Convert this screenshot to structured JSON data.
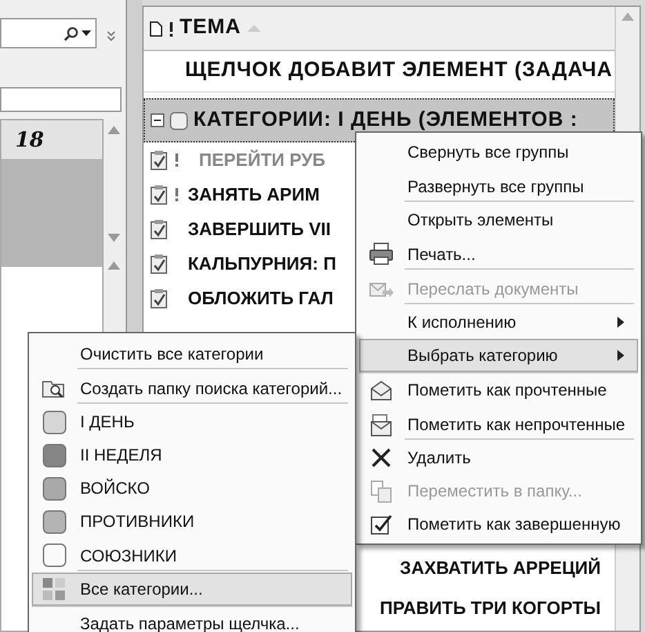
{
  "calendar": {
    "day": "18"
  },
  "task_list": {
    "column": "ТЕМА",
    "new_item_row": "ЩЕЛЧОК ДОБАВИТ ЭЛЕМЕНТ (ЗАДАЧА",
    "group": {
      "label": "КАТЕГОРИИ: I ДЕНЬ (ЭЛЕМЕНТОВ :",
      "expanded": true,
      "selected": true
    },
    "rows": [
      {
        "subject": "ПЕРЕЙТИ РУБ",
        "important": true,
        "dimmed": true,
        "kind": "task"
      },
      {
        "subject": "ЗАНЯТЬ АРИМ",
        "important": true,
        "dimmed": false,
        "kind": "task"
      },
      {
        "subject": "ЗАВЕРШИТЬ VII",
        "important": false,
        "dimmed": false,
        "kind": "task"
      },
      {
        "subject": "КАЛЬПУРНИЯ: П",
        "important": false,
        "dimmed": false,
        "kind": "task"
      },
      {
        "subject": "ОБЛОЖИТЬ ГАЛ",
        "important": false,
        "dimmed": false,
        "kind": "task"
      },
      {
        "subject": "ЗАХВАТИТЬ АРРЕЦИЙ",
        "kind": "covered"
      },
      {
        "subject": "ПРАВИТЬ ТРИ КОГОРТЫ",
        "kind": "covered"
      }
    ]
  },
  "context_menu": {
    "items": [
      {
        "label": "Свернуть все группы",
        "kind": "plain",
        "disabled": false,
        "submenu": false,
        "selected": false,
        "divider_after": false
      },
      {
        "label": "Развернуть все группы",
        "kind": "plain",
        "disabled": false,
        "submenu": false,
        "selected": false,
        "divider_after": true
      },
      {
        "label": "Открыть элементы",
        "kind": "plain",
        "disabled": false,
        "submenu": false,
        "selected": false,
        "divider_after": false
      },
      {
        "label": "Печать...",
        "kind": "printer",
        "disabled": false,
        "submenu": false,
        "selected": false,
        "divider_after": true
      },
      {
        "label": "Переслать документы",
        "kind": "forward",
        "disabled": true,
        "submenu": false,
        "selected": false,
        "divider_after": true
      },
      {
        "label": "К исполнению",
        "kind": "plain",
        "disabled": false,
        "submenu": true,
        "selected": false,
        "divider_after": false
      },
      {
        "label": "Выбрать категорию",
        "kind": "plain",
        "disabled": false,
        "submenu": true,
        "selected": true,
        "divider_after": true
      },
      {
        "label": "Пометить как прочтенные",
        "kind": "read",
        "disabled": false,
        "submenu": false,
        "selected": false,
        "divider_after": false
      },
      {
        "label": "Пометить как непрочтенные",
        "kind": "unread",
        "disabled": false,
        "submenu": false,
        "selected": false,
        "divider_after": true
      },
      {
        "label": "Удалить",
        "kind": "delete",
        "disabled": false,
        "submenu": false,
        "selected": false,
        "divider_after": false
      },
      {
        "label": "Переместить в папку...",
        "kind": "move",
        "disabled": true,
        "submenu": false,
        "selected": false,
        "divider_after": false
      },
      {
        "label": "Пометить как завершенную",
        "kind": "complete",
        "disabled": false,
        "submenu": false,
        "selected": false,
        "divider_after": false
      }
    ]
  },
  "category_menu": {
    "items": [
      {
        "label": "Очистить все категории",
        "kind": "plain",
        "selected": false,
        "divider_after": true
      },
      {
        "label": "Создать папку поиска категорий...",
        "kind": "search",
        "selected": false,
        "divider_after": true
      },
      {
        "label": "I ДЕНЬ",
        "kind": "category",
        "color": "#d6d6d6",
        "selected": false,
        "divider_after": false
      },
      {
        "label": "II НЕДЕЛЯ",
        "kind": "category",
        "color": "#858585",
        "selected": false,
        "divider_after": false
      },
      {
        "label": "ВОЙСКО",
        "kind": "category",
        "color": "#a9a9a9",
        "selected": false,
        "divider_after": false
      },
      {
        "label": "ПРОТИВНИКИ",
        "kind": "category",
        "color": "#b4b4b4",
        "selected": false,
        "divider_after": false
      },
      {
        "label": "СОЮЗНИКИ",
        "kind": "category",
        "color": "#fafafa",
        "selected": false,
        "divider_after": true
      },
      {
        "label": "Все категории...",
        "kind": "all",
        "selected": true,
        "divider_after": true
      },
      {
        "label": "Задать параметры щелчка...",
        "kind": "plain",
        "selected": false,
        "divider_after": false
      }
    ]
  }
}
